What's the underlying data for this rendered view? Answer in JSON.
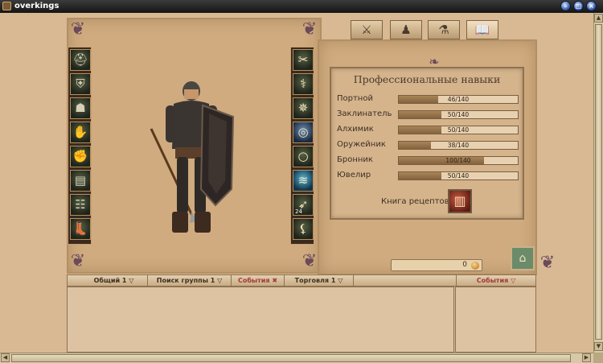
{
  "window": {
    "title": "overkings",
    "controls": [
      "minimize",
      "maximize",
      "close"
    ]
  },
  "tabs": [
    {
      "icon": "crossed-swords-icon",
      "glyph": "⚔",
      "active": false
    },
    {
      "icon": "party-icon",
      "glyph": "♟",
      "active": false
    },
    {
      "icon": "alchemy-icon",
      "glyph": "⚗",
      "active": false
    },
    {
      "icon": "book-icon",
      "glyph": "📖",
      "active": true
    }
  ],
  "skills": {
    "title": "Профессиональные навыки",
    "rows": [
      {
        "name": "Портной",
        "value": 46,
        "max": 140,
        "label": "46/140"
      },
      {
        "name": "Заклинатель",
        "value": 50,
        "max": 140,
        "label": "50/140"
      },
      {
        "name": "Алхимик",
        "value": 50,
        "max": 140,
        "label": "50/140"
      },
      {
        "name": "Оружейник",
        "value": 38,
        "max": 140,
        "label": "38/140"
      },
      {
        "name": "Бронник",
        "value": 100,
        "max": 140,
        "label": "100/140"
      },
      {
        "name": "Ювелир",
        "value": 50,
        "max": 140,
        "label": "50/140"
      }
    ],
    "recipes_label": "Книга рецептов"
  },
  "equipment": {
    "left": [
      {
        "name": "helmet-slot",
        "icon": "helmet-icon",
        "glyph": "⛑"
      },
      {
        "name": "shoulders-slot",
        "icon": "shoulder-armor-icon",
        "glyph": "⛨"
      },
      {
        "name": "chest-slot",
        "icon": "chest-armor-icon",
        "glyph": "☗"
      },
      {
        "name": "arms-slot",
        "icon": "bracers-icon",
        "glyph": "✋"
      },
      {
        "name": "gloves-slot",
        "icon": "gloves-icon",
        "glyph": "✊"
      },
      {
        "name": "belt-slot",
        "icon": "belt-icon",
        "glyph": "▤"
      },
      {
        "name": "legs-slot",
        "icon": "leg-armor-icon",
        "glyph": "☷"
      },
      {
        "name": "boots-slot",
        "icon": "boots-icon",
        "glyph": "👢"
      }
    ],
    "right": [
      {
        "name": "weapon-slot",
        "icon": "scissors-weapon-icon",
        "glyph": "✂",
        "color": "",
        "count": ""
      },
      {
        "name": "amulet-slot",
        "icon": "amulet-icon",
        "glyph": "⚕",
        "color": "",
        "count": ""
      },
      {
        "name": "rune-slot",
        "icon": "rune-icon",
        "glyph": "✵",
        "color": "",
        "count": ""
      },
      {
        "name": "ring1-slot",
        "icon": "ring-icon",
        "glyph": "◎",
        "color": "blue",
        "count": ""
      },
      {
        "name": "ring2-slot",
        "icon": "ring-icon",
        "glyph": "○",
        "color": "",
        "count": ""
      },
      {
        "name": "charm-slot",
        "icon": "wave-charm-icon",
        "glyph": "≋",
        "color": "teal",
        "count": ""
      },
      {
        "name": "arrows-slot",
        "icon": "arrows-icon",
        "glyph": "➶",
        "color": "",
        "count": "24"
      },
      {
        "name": "trinket-slot",
        "icon": "claw-icon",
        "glyph": "⚸",
        "color": "",
        "count": ""
      }
    ]
  },
  "gold": {
    "value": "0",
    "icon": "coin-icon"
  },
  "chat": {
    "tabs": [
      {
        "label": "Общий 1",
        "icon": "chevron-down-icon"
      },
      {
        "label": "Поиск группы 1",
        "icon": "chevron-down-icon"
      },
      {
        "label": "События",
        "icon": "close-icon"
      },
      {
        "label": "Торговля 1",
        "icon": "chevron-down-icon"
      }
    ],
    "side_tab": {
      "label": "События",
      "icon": "chevron-down-icon"
    }
  },
  "colors": {
    "parchment": "#d0ab7f",
    "bar_fill": "#84633d",
    "title_bar": "#151515"
  }
}
